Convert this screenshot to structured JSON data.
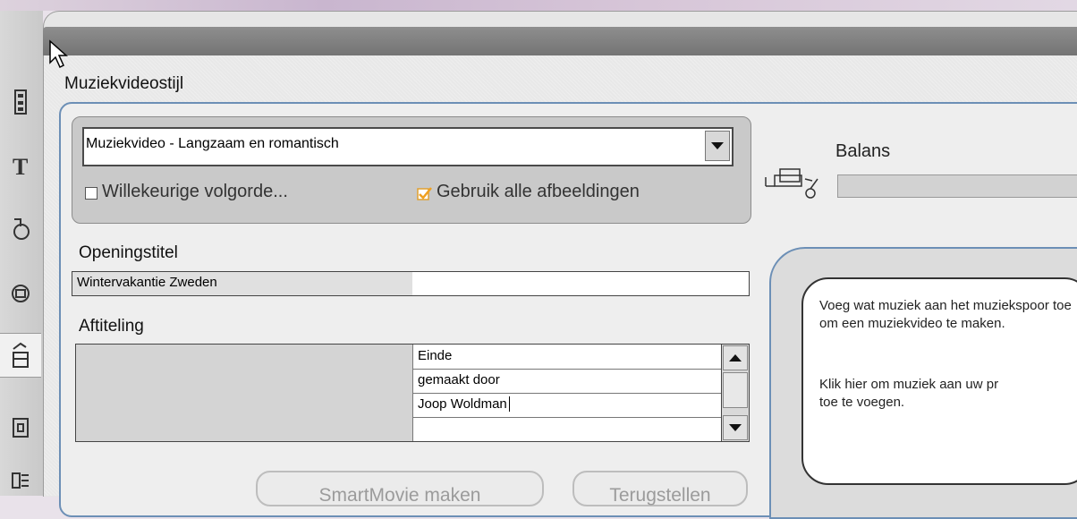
{
  "panel": {
    "section_title": "Muziekvideostijl"
  },
  "style": {
    "selected": "Muziekvideo - Langzaam en romantisch",
    "random_order_label": "Willekeurige volgorde...",
    "random_order_checked": false,
    "use_all_label": "Gebruik alle afbeeldingen",
    "use_all_checked": true
  },
  "opening": {
    "label": "Openingstitel",
    "value": "Wintervakantie Zweden"
  },
  "credits": {
    "label": "Aftiteling",
    "rows": [
      "Einde",
      "gemaakt door",
      "Joop Woldman",
      ""
    ]
  },
  "buttons": {
    "smartmovie": "SmartMovie maken",
    "reset": "Terugstellen"
  },
  "balance": {
    "label": "Balans"
  },
  "tip": {
    "line1": "Voeg wat muziek aan het muziekspoor toe om een muziekvideo te maken.",
    "line2": "Klik hier om muziek aan uw pr",
    "line3": "toe te voegen."
  },
  "colors": {
    "frame_border": "#6c8fb6",
    "checkbox_check": "#f0a020"
  },
  "icons": {
    "left_tools": [
      "video-icon",
      "title-icon",
      "transition-icon",
      "effects-icon",
      "smartmovie-icon",
      "disc-icon",
      "audio-icon"
    ]
  }
}
